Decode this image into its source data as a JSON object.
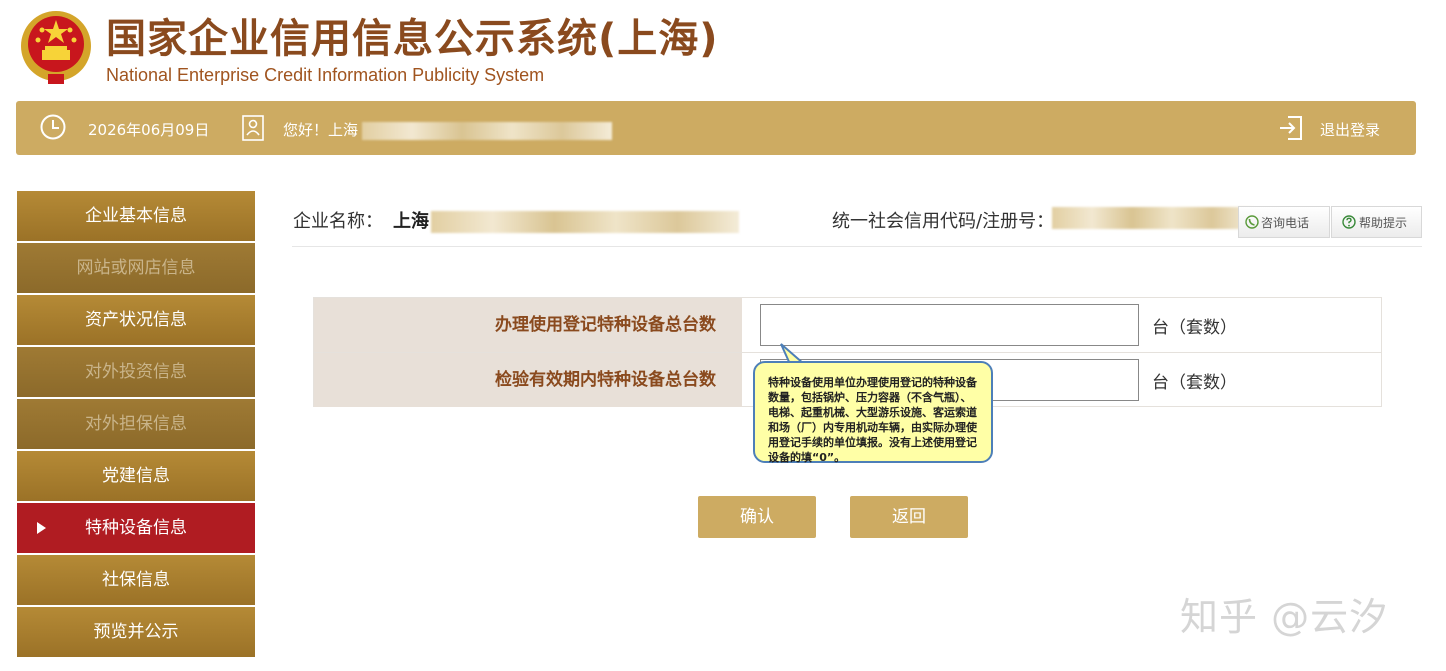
{
  "header": {
    "title_cn": "国家企业信用信息公示系统(上海)",
    "title_en": "National Enterprise Credit Information Publicity System"
  },
  "topbar": {
    "date": "2026年06月09日",
    "greeting": "您好！上海",
    "logout_label": "退出登录"
  },
  "sidebar": {
    "items": [
      {
        "label": "企业基本信息",
        "state": "normal"
      },
      {
        "label": "网站或网店信息",
        "state": "disabled"
      },
      {
        "label": "资产状况信息",
        "state": "normal"
      },
      {
        "label": "对外投资信息",
        "state": "disabled"
      },
      {
        "label": "对外担保信息",
        "state": "disabled"
      },
      {
        "label": "党建信息",
        "state": "normal"
      },
      {
        "label": "特种设备信息",
        "state": "active"
      },
      {
        "label": "社保信息",
        "state": "normal"
      },
      {
        "label": "预览并公示",
        "state": "normal"
      }
    ]
  },
  "company": {
    "name_label": "企业名称：",
    "name_value": "上海",
    "code_label": "统一社会信用代码/注册号："
  },
  "toolbar": {
    "consult_label": "咨询电话",
    "help_label": "帮助提示"
  },
  "form": {
    "rows": [
      {
        "label": "办理使用登记特种设备总台数",
        "value": "",
        "unit": "台（套数）"
      },
      {
        "label": "检验有效期内特种设备总台数",
        "value": "",
        "unit": "台（套数）"
      }
    ]
  },
  "tooltip": {
    "text": "特种设备使用单位办理使用登记的特种设备数量，包括锅炉、压力容器（不含气瓶）、电梯、起重机械、大型游乐设施、客运索道和场（厂）内专用机动车辆，由实际办理使用登记手续的单位填报。没有上述使用登记设备的填“0”。"
  },
  "actions": {
    "confirm_label": "确认",
    "back_label": "返回"
  },
  "watermark": "知乎 @云汐",
  "colors": {
    "gold": "#cdab62",
    "sidebar_brown": "#b58a36",
    "active_red": "#b01c22",
    "title_brown": "#8a4a1e",
    "tooltip_bg": "#ffffa6",
    "tooltip_border": "#4d7fb8"
  },
  "icons": {
    "emblem": "national-emblem",
    "date": "clock-icon",
    "user": "user-icon",
    "logout": "logout-icon",
    "consult": "phone-icon",
    "help": "question-icon"
  }
}
